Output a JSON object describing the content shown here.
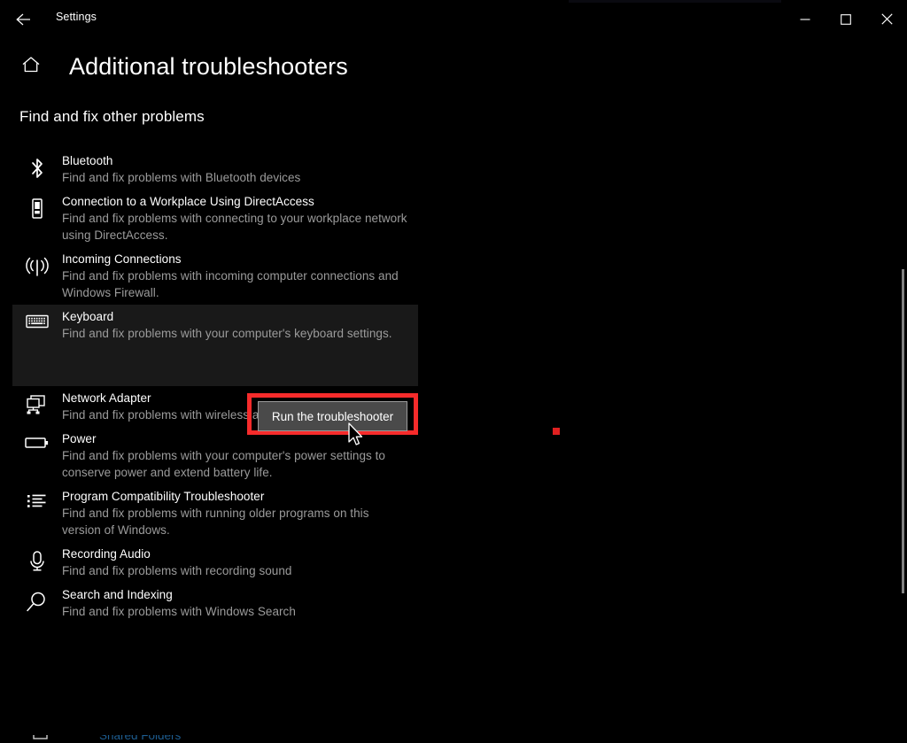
{
  "window": {
    "app_title": "Settings",
    "back_icon": "back-arrow-icon",
    "minimize_label": "Minimize",
    "maximize_label": "Maximize",
    "close_label": "Close"
  },
  "header": {
    "home_icon": "home-icon",
    "page_title": "Additional troubleshooters"
  },
  "section": {
    "heading": "Find and fix other problems"
  },
  "items": [
    {
      "icon": "bluetooth-icon",
      "name": "Bluetooth",
      "desc": "Find and fix problems with Bluetooth devices",
      "selected": false
    },
    {
      "icon": "workplace-device-icon",
      "name": "Connection to a Workplace Using DirectAccess",
      "desc": "Find and fix problems with connecting to your workplace network using DirectAccess.",
      "selected": false
    },
    {
      "icon": "incoming-connections-icon",
      "name": "Incoming Connections",
      "desc": "Find and fix problems with incoming computer connections and Windows Firewall.",
      "selected": false
    },
    {
      "icon": "keyboard-icon",
      "name": "Keyboard",
      "desc": "Find and fix problems with your computer's keyboard settings.",
      "selected": true
    },
    {
      "icon": "network-adapter-icon",
      "name": "Network Adapter",
      "desc": "Find and fix problems with wireless and other network adapters.",
      "selected": false
    },
    {
      "icon": "power-battery-icon",
      "name": "Power",
      "desc": "Find and fix problems with your computer's power settings to conserve power and extend battery life.",
      "selected": false
    },
    {
      "icon": "program-list-icon",
      "name": "Program Compatibility Troubleshooter",
      "desc": "Find and fix problems with running older programs on this version of Windows.",
      "selected": false
    },
    {
      "icon": "microphone-icon",
      "name": "Recording Audio",
      "desc": "Find and fix problems with recording sound",
      "selected": false
    },
    {
      "icon": "search-magnifier-icon",
      "name": "Search and Indexing",
      "desc": "Find and fix problems with Windows Search",
      "selected": false
    }
  ],
  "clipped_item": {
    "name": "Shared Folders"
  },
  "action": {
    "run_button_label": "Run the troubleshooter",
    "highlight_color": "#f62b2b"
  },
  "annotation": {
    "cursor": "arrow-cursor",
    "click_marker_color": "#e02020"
  },
  "colors": {
    "background": "#000000",
    "selected_row": "#191919",
    "button_face": "#4a4a4a",
    "button_border": "#9a9a9a",
    "secondary_text": "#9b9b9b",
    "scrollbar_thumb": "#828282"
  }
}
